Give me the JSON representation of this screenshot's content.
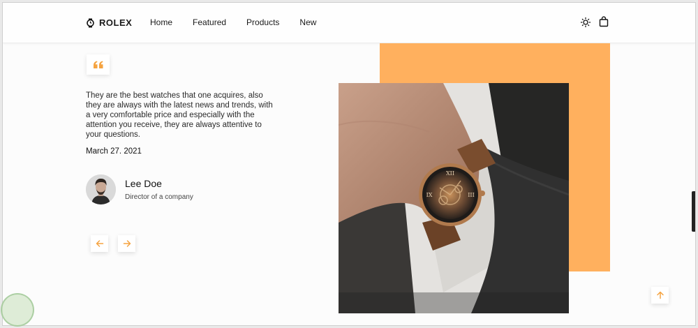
{
  "brand": {
    "name": "ROLEX",
    "icon": "watch-icon"
  },
  "nav": {
    "items": [
      "Home",
      "Featured",
      "Products",
      "New"
    ]
  },
  "header_icons": {
    "theme": "sun-icon",
    "bag": "shopping-bag-icon"
  },
  "testimonial": {
    "quote_icon": "quote-icon",
    "text": "They are the best watches that one acquires, also they are always with the latest news and trends, with a very comfortable price and especially with the attention you receive, they are always attentive to your questions.",
    "date": "March 27. 2021",
    "author": {
      "name": "Lee Doe",
      "role": "Director of a company"
    }
  },
  "controls": {
    "prev": "arrow-left-icon",
    "next": "arrow-right-icon",
    "scroll_top": "arrow-up-icon"
  },
  "colors": {
    "accent": "#ffb05e",
    "arrow": "#f5a340"
  }
}
